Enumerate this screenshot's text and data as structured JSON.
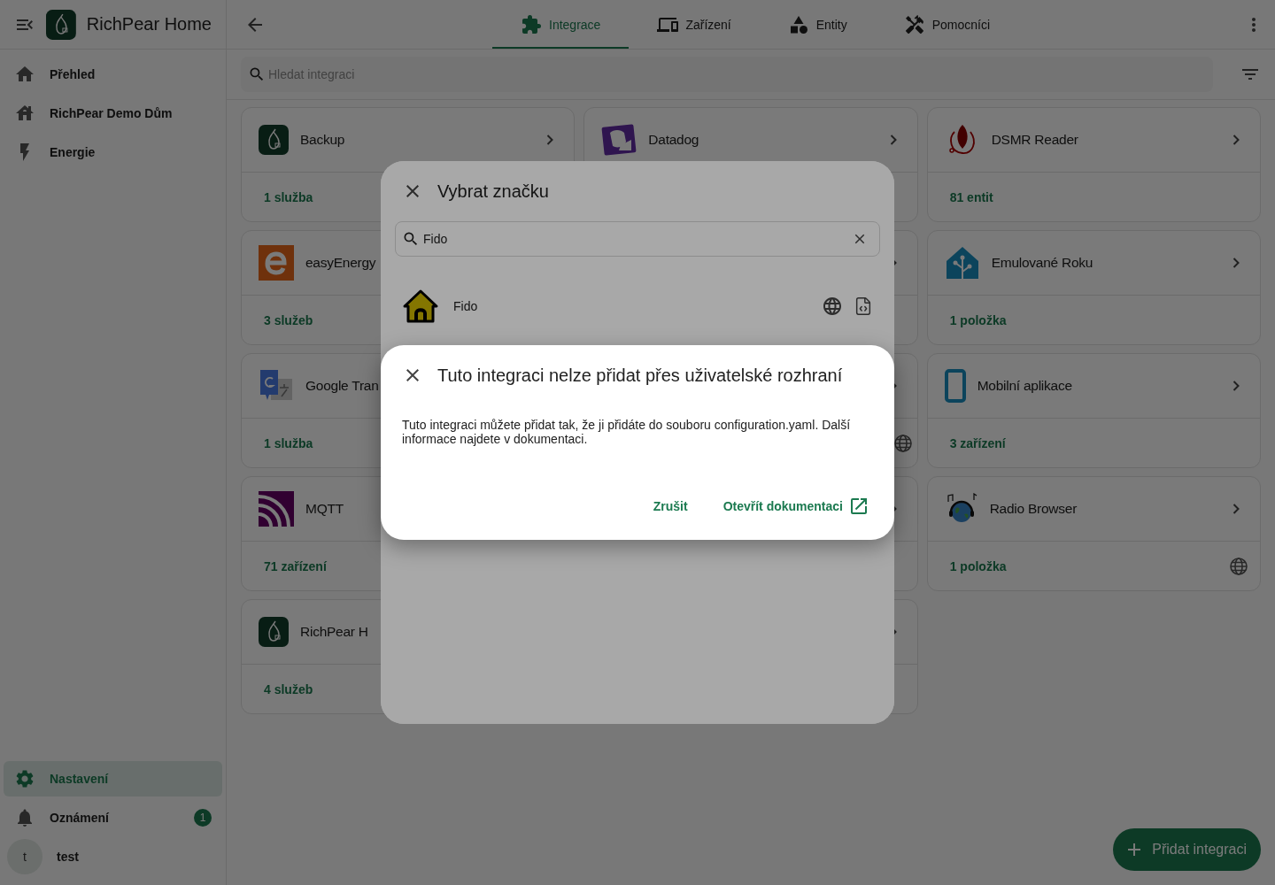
{
  "app": {
    "title": "RichPear Home"
  },
  "sidebar": {
    "items": [
      {
        "label": "Přehled",
        "selected": false
      },
      {
        "label": "RichPear Demo Dům",
        "selected": false
      },
      {
        "label": "Energie",
        "selected": false
      }
    ],
    "bottom_items": [
      {
        "label": "Nastavení",
        "selected": true
      },
      {
        "label": "Oznámení",
        "selected": false,
        "badge": "1"
      }
    ],
    "user": {
      "initial": "t",
      "name": "test"
    }
  },
  "tabs": [
    {
      "label": "Integrace",
      "selected": true
    },
    {
      "label": "Zařízení",
      "selected": false
    },
    {
      "label": "Entity",
      "selected": false
    },
    {
      "label": "Pomocníci",
      "selected": false
    }
  ],
  "search": {
    "placeholder": "Hledat integraci"
  },
  "cards": [
    {
      "kind": "full",
      "title": "Backup",
      "count": "1 služba",
      "chevron": true
    },
    {
      "kind": "full",
      "title": "Datadog",
      "chevron": true
    },
    {
      "kind": "full",
      "title": "DSMR Reader",
      "count": "81 entit",
      "chevron": true
    },
    {
      "kind": "full",
      "title": "easyEnergy",
      "count": "3 služeb"
    },
    {
      "kind": "covered",
      "chevron": true
    },
    {
      "kind": "full",
      "title": "Emulované Roku",
      "count": "1 položka",
      "chevron": true
    },
    {
      "kind": "full",
      "title": "Google Tran",
      "count": "1 služba"
    },
    {
      "kind": "covered",
      "chevron": true,
      "web_based": true
    },
    {
      "kind": "full",
      "title": "Mobilní aplikace",
      "count": "3 zařízení",
      "chevron": true
    },
    {
      "kind": "full",
      "title": "MQTT",
      "count": "71 zařízení"
    },
    {
      "kind": "covered",
      "chevron": true
    },
    {
      "kind": "full",
      "title": "Radio Browser",
      "count": "1 položka",
      "chevron": true,
      "web_based": true
    },
    {
      "kind": "full",
      "title": "RichPear H",
      "count": "4 služeb"
    },
    {
      "kind": "covered",
      "chevron": true
    }
  ],
  "add_button": "Přidat integraci",
  "brand_dialog": {
    "title": "Vybrat značku",
    "search_value": "Fido",
    "results": [
      {
        "name": "Fido"
      }
    ]
  },
  "alert_dialog": {
    "title": "Tuto integraci nelze přidat přes uživatelské rozhraní",
    "body": "Tuto integraci můžete přidat tak, že ji přidáte do souboru configuration.yaml. Další informace najdete v dokumentaci.",
    "buttons": [
      "Zrušit",
      "Otevřít dokumentaci"
    ]
  }
}
